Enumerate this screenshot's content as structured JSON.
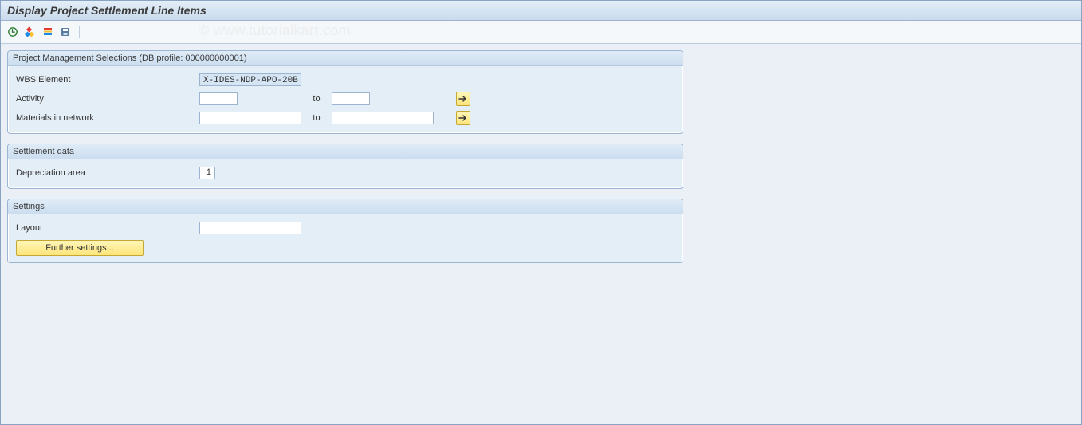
{
  "window": {
    "title": "Display Project Settlement Line Items"
  },
  "watermark": "© www.tutorialkart.com",
  "toolbar": {
    "icons": [
      "execute",
      "variant",
      "list",
      "save"
    ]
  },
  "panels": {
    "pm": {
      "title": "Project Management Selections (DB profile: 000000000001)",
      "wbs_label": "WBS Element",
      "wbs_value": "X-IDES-NDP-APO-20B",
      "activity_label": "Activity",
      "activity_from": "",
      "activity_to_label": "to",
      "activity_to": "",
      "materials_label": "Materials in network",
      "materials_from": "",
      "materials_to_label": "to",
      "materials_to": ""
    },
    "settlement": {
      "title": "Settlement data",
      "depr_label": "Depreciation area",
      "depr_value": "1"
    },
    "settings": {
      "title": "Settings",
      "layout_label": "Layout",
      "layout_value": "",
      "further_btn": "Further settings..."
    }
  }
}
